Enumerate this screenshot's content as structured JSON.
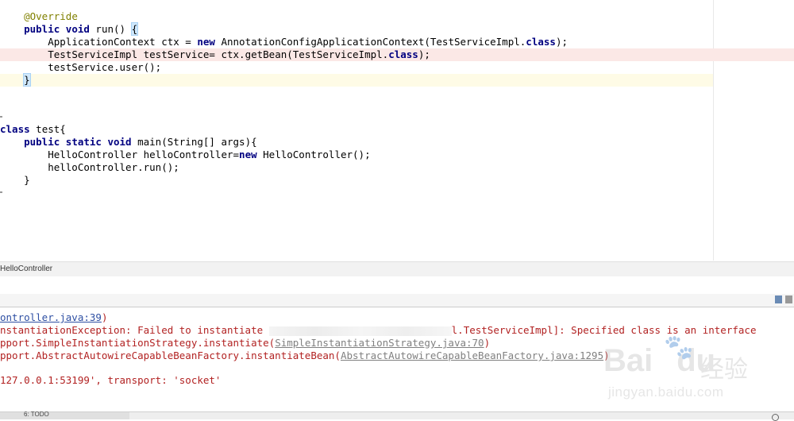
{
  "editor": {
    "annotation": "@Override",
    "run_decl": {
      "kw": "public void",
      "rest": " run() ",
      "brace": "{"
    },
    "ctx_line": {
      "indent": "        ",
      "pre": "ApplicationContext ctx = ",
      "kw": "new",
      "post": " AnnotationConfigApplicationContext(TestServiceImpl.",
      "kw2": "class",
      "end": ");"
    },
    "bean_line": {
      "indent": "        ",
      "pre": "TestServiceImpl testService= ctx.getBean(TestServiceImpl.",
      "kw": "class",
      "end": ");"
    },
    "user_line": "        testService.user();",
    "close_brace": "}",
    "class_line": {
      "kw": "class",
      "rest": " test{"
    },
    "main_decl": {
      "indent": "    ",
      "kw": "public static void",
      "rest": " main(String[] args){"
    },
    "hello_line": {
      "indent": "        ",
      "pre": "HelloController helloController=",
      "kw": "new",
      "post": " HelloController();"
    },
    "hello_run": "        helloController.run();",
    "inner_close": "    }",
    "outer_close": "}"
  },
  "breadcrumb": {
    "label": "HelloController"
  },
  "console": {
    "line1_link": "ontroller.java:39",
    "line1_end": ")",
    "line2_pre": "nstantiationException: Failed to instantiate ",
    "line2_post": "l.TestServiceImpl]: Specified class is an interface",
    "line3_pre": "pport.SimpleInstantiationStrategy.instantiate(",
    "line3_link": "SimpleInstantiationStrategy.java:70",
    "line3_end": ")",
    "line4_pre": "pport.AbstractAutowireCapableBeanFactory.instantiateBean(",
    "line4_link": "AbstractAutowireCapableBeanFactory.java:1295",
    "line4_end": ")",
    "line5": "127.0.0.1:53199', transport: 'socket'"
  },
  "statusbar": {
    "tab_label": "6: TODO"
  },
  "watermark": {
    "brand": "Bai",
    "brand2": "du",
    "cn": "经验",
    "url": "jingyan.baidu.com"
  },
  "colors": {
    "keyword": "#000080",
    "annotation": "#808000",
    "error_text": "#b22222",
    "link": "#2e4fa3",
    "error_line_bg": "#fbe8e6",
    "caret_line_bg": "#fefbe6"
  }
}
